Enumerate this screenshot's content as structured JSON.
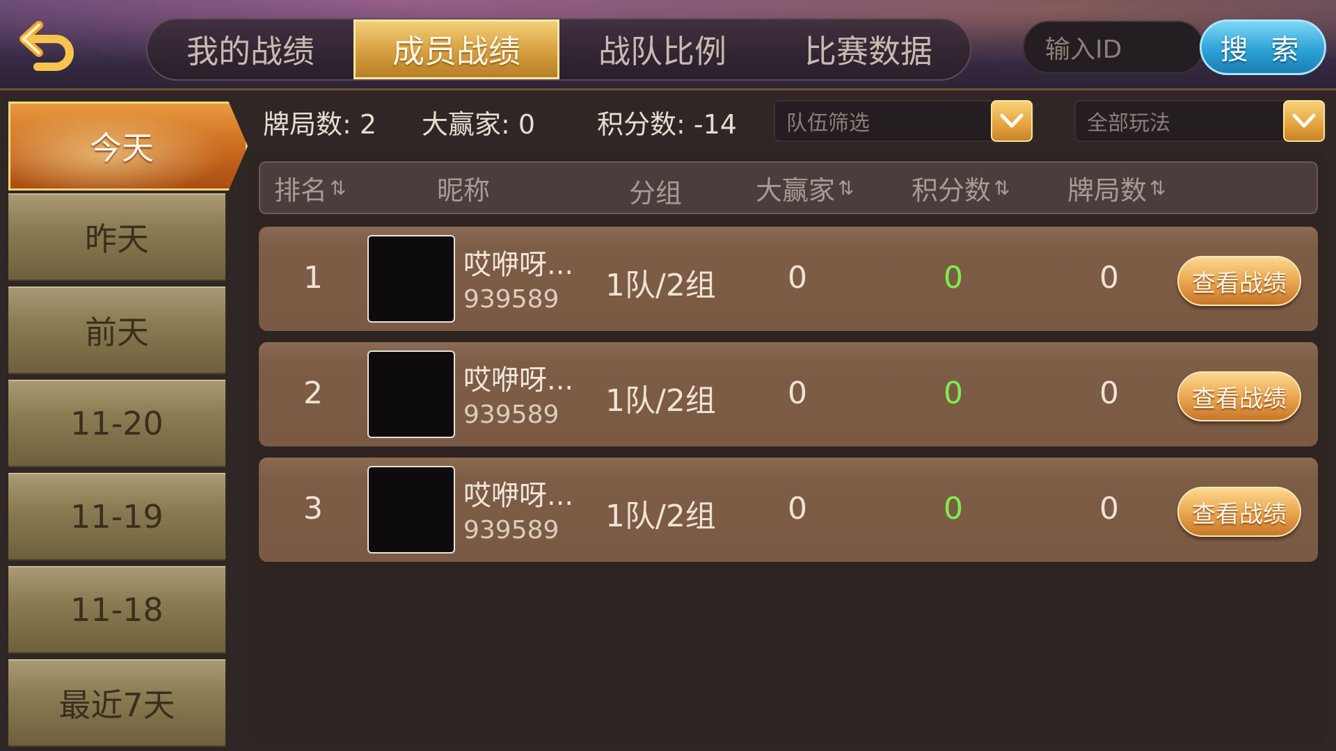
{
  "header": {
    "tabs": [
      {
        "label": "我的战绩",
        "active": false
      },
      {
        "label": "成员战绩",
        "active": true
      },
      {
        "label": "战队比例",
        "active": false
      },
      {
        "label": "比赛数据",
        "active": false
      }
    ],
    "search": {
      "placeholder": "输入ID",
      "button_label": "搜 索"
    },
    "back_icon": "back-arrow-icon"
  },
  "sidebar": {
    "items": [
      {
        "label": "今天",
        "active": true
      },
      {
        "label": "昨天",
        "active": false
      },
      {
        "label": "前天",
        "active": false
      },
      {
        "label": "11-20",
        "active": false
      },
      {
        "label": "11-19",
        "active": false
      },
      {
        "label": "11-18",
        "active": false
      },
      {
        "label": "最近7天",
        "active": false
      }
    ]
  },
  "summary": {
    "games": "牌局数: 2",
    "big_winner": "大赢家: 0",
    "score": "积分数: -14",
    "team_filter": "队伍筛选",
    "mode_filter": "全部玩法"
  },
  "table": {
    "columns": [
      "排名",
      "昵称",
      "分组",
      "大赢家",
      "积分数",
      "牌局数"
    ],
    "sort_icon": "⇅",
    "rows": [
      {
        "rank": "1",
        "nickname": "哎咿呀...",
        "id": "939589",
        "group": "1队/2组",
        "big_winner": "0",
        "score": "0",
        "games": "0",
        "action": "查看战绩"
      },
      {
        "rank": "2",
        "nickname": "哎咿呀...",
        "id": "939589",
        "group": "1队/2组",
        "big_winner": "0",
        "score": "0",
        "games": "0",
        "action": "查看战绩"
      },
      {
        "rank": "3",
        "nickname": "哎咿呀...",
        "id": "939589",
        "group": "1队/2组",
        "big_winner": "0",
        "score": "0",
        "games": "0",
        "action": "查看战绩"
      }
    ]
  },
  "colors": {
    "accent_gold": "#e4a43c",
    "score_green": "#7cf04a",
    "search_blue": "#2ea2d6"
  }
}
